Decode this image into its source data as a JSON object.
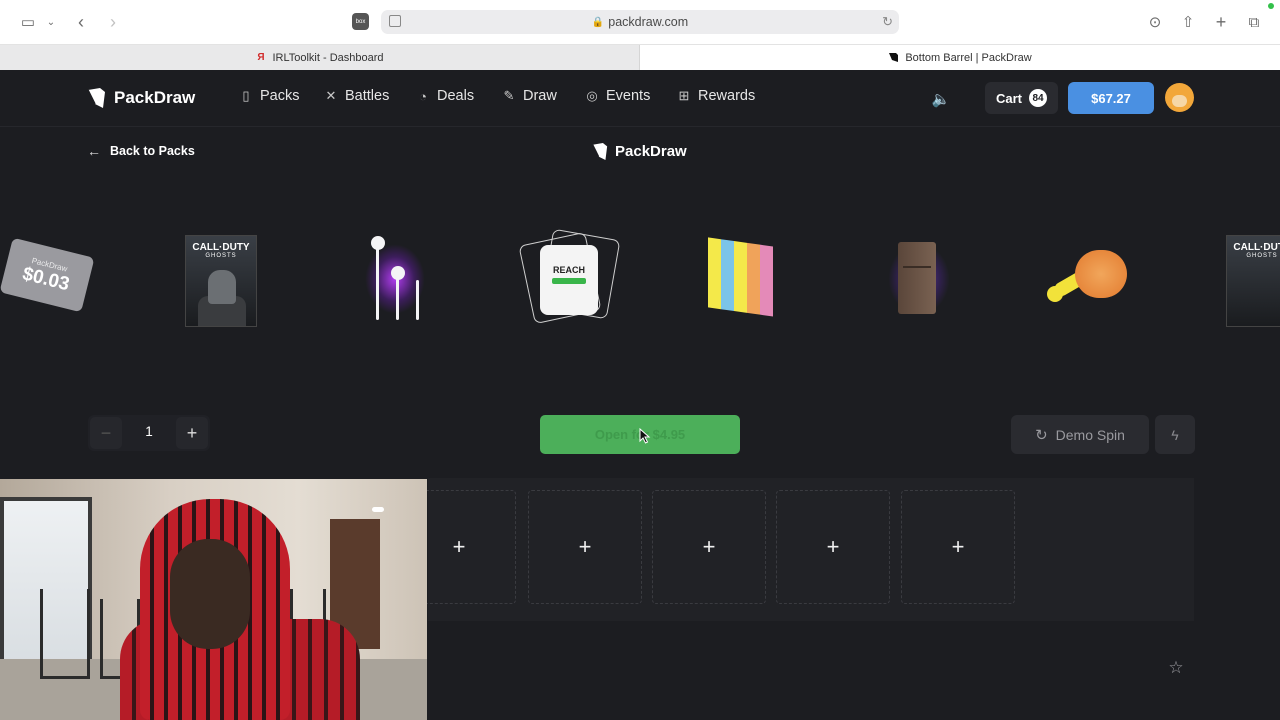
{
  "browser": {
    "url": "packdraw.com",
    "tabs": [
      {
        "label": "IRLToolkit - Dashboard",
        "active": false
      },
      {
        "label": "Bottom Barrel | PackDraw",
        "active": true
      }
    ],
    "box_badge": "box"
  },
  "site": {
    "logo": "PackDraw",
    "nav": [
      {
        "label": "Packs",
        "icon": "pack-icon"
      },
      {
        "label": "Battles",
        "icon": "swords-icon"
      },
      {
        "label": "Deals",
        "icon": "deals-icon"
      },
      {
        "label": "Draw",
        "icon": "draw-icon"
      },
      {
        "label": "Events",
        "icon": "events-icon"
      },
      {
        "label": "Rewards",
        "icon": "gift-icon"
      }
    ],
    "cart_label": "Cart",
    "cart_count": "84",
    "balance": "$67.27"
  },
  "page": {
    "back_label": "Back to Packs",
    "center_logo": "PackDraw",
    "carousel": {
      "ticket_brand": "PackDraw",
      "ticket_amount": "$0.03",
      "cod_title": "CALL·DUTY",
      "cod_subtitle": "GHOSTS",
      "floss_brand": "REACH"
    },
    "quantity": "1",
    "open_button": "Open for $4.95",
    "demo_spin": "Demo Spin",
    "slot_plus": "+"
  },
  "colors": {
    "accent_blue": "#4a90e2",
    "open_green": "#4caf5a",
    "background": "#1c1d21"
  }
}
